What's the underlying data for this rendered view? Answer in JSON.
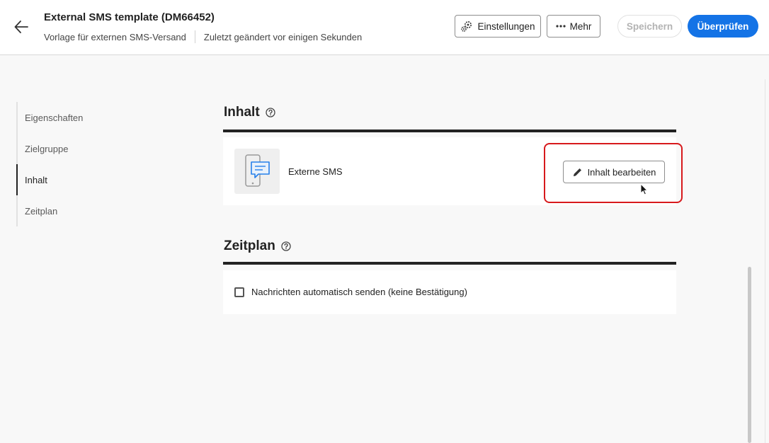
{
  "header": {
    "title": "External SMS template (DM66452)",
    "subtitle_type": "Vorlage für externen SMS-Versand",
    "subtitle_status": "Zuletzt geändert vor einigen Sekunden",
    "back_icon": "arrow-left-icon",
    "settings_label": "Einstellungen",
    "settings_icon": "gears-icon",
    "more_label": "Mehr",
    "more_icon": "more-dots-icon",
    "save_label": "Speichern",
    "review_label": "Überprüfen",
    "accent_color": "#1473e6"
  },
  "nav": {
    "items": [
      {
        "label": "Eigenschaften"
      },
      {
        "label": "Zielgruppe"
      },
      {
        "label": "Inhalt"
      },
      {
        "label": "Zeitplan"
      }
    ],
    "active": "Inhalt"
  },
  "content_section": {
    "title": "Inhalt",
    "help_icon": "help-circle-icon",
    "channel_label": "Externe SMS",
    "channel_icon": "sms-phone-icon",
    "edit_label": "Inhalt bearbeiten",
    "edit_icon": "pencil-icon",
    "highlight_color": "#d7191c"
  },
  "schedule_section": {
    "title": "Zeitplan",
    "help_icon": "help-circle-icon",
    "auto_send_label": "Nachrichten automatisch senden (keine Bestätigung)",
    "auto_send_checked": false
  }
}
